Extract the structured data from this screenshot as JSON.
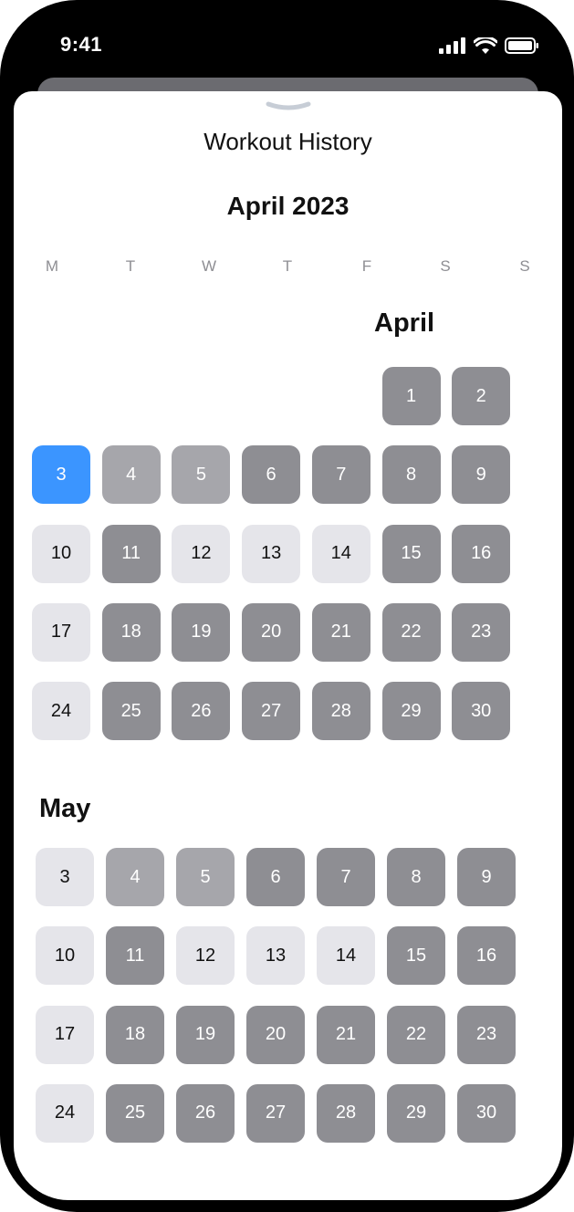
{
  "status": {
    "time": "9:41"
  },
  "sheet": {
    "title": "Workout History"
  },
  "header": {
    "month": "April 2023"
  },
  "weekdays": [
    "M",
    "T",
    "W",
    "T",
    "F",
    "S",
    "S"
  ],
  "colors": {
    "dark": "#8e8e93",
    "mid": "#a6a6ab",
    "light": "#e5e5ea",
    "selected": "#3b95ff"
  },
  "months": [
    {
      "label": "April",
      "rows": [
        [
          null,
          null,
          null,
          null,
          null,
          {
            "d": "1",
            "s": "dark"
          },
          {
            "d": "2",
            "s": "dark"
          }
        ],
        [
          {
            "d": "3",
            "s": "selected"
          },
          {
            "d": "4",
            "s": "mid"
          },
          {
            "d": "5",
            "s": "mid"
          },
          {
            "d": "6",
            "s": "dark"
          },
          {
            "d": "7",
            "s": "dark"
          },
          {
            "d": "8",
            "s": "dark"
          },
          {
            "d": "9",
            "s": "dark"
          }
        ],
        [
          {
            "d": "10",
            "s": "light"
          },
          {
            "d": "11",
            "s": "dark"
          },
          {
            "d": "12",
            "s": "light"
          },
          {
            "d": "13",
            "s": "light"
          },
          {
            "d": "14",
            "s": "light"
          },
          {
            "d": "15",
            "s": "dark"
          },
          {
            "d": "16",
            "s": "dark"
          }
        ],
        [
          {
            "d": "17",
            "s": "light"
          },
          {
            "d": "18",
            "s": "dark"
          },
          {
            "d": "19",
            "s": "dark"
          },
          {
            "d": "20",
            "s": "dark"
          },
          {
            "d": "21",
            "s": "dark"
          },
          {
            "d": "22",
            "s": "dark"
          },
          {
            "d": "23",
            "s": "dark"
          }
        ],
        [
          {
            "d": "24",
            "s": "light"
          },
          {
            "d": "25",
            "s": "dark"
          },
          {
            "d": "26",
            "s": "dark"
          },
          {
            "d": "27",
            "s": "dark"
          },
          {
            "d": "28",
            "s": "dark"
          },
          {
            "d": "29",
            "s": "dark"
          },
          {
            "d": "30",
            "s": "dark"
          }
        ]
      ]
    },
    {
      "label": "May",
      "rows": [
        [
          {
            "d": "3",
            "s": "light"
          },
          {
            "d": "4",
            "s": "mid"
          },
          {
            "d": "5",
            "s": "mid"
          },
          {
            "d": "6",
            "s": "dark"
          },
          {
            "d": "7",
            "s": "dark"
          },
          {
            "d": "8",
            "s": "dark"
          },
          {
            "d": "9",
            "s": "dark"
          }
        ],
        [
          {
            "d": "10",
            "s": "light"
          },
          {
            "d": "11",
            "s": "dark"
          },
          {
            "d": "12",
            "s": "light"
          },
          {
            "d": "13",
            "s": "light"
          },
          {
            "d": "14",
            "s": "light"
          },
          {
            "d": "15",
            "s": "dark"
          },
          {
            "d": "16",
            "s": "dark"
          }
        ],
        [
          {
            "d": "17",
            "s": "light"
          },
          {
            "d": "18",
            "s": "dark"
          },
          {
            "d": "19",
            "s": "dark"
          },
          {
            "d": "20",
            "s": "dark"
          },
          {
            "d": "21",
            "s": "dark"
          },
          {
            "d": "22",
            "s": "dark"
          },
          {
            "d": "23",
            "s": "dark"
          }
        ],
        [
          {
            "d": "24",
            "s": "light"
          },
          {
            "d": "25",
            "s": "dark"
          },
          {
            "d": "26",
            "s": "dark"
          },
          {
            "d": "27",
            "s": "dark"
          },
          {
            "d": "28",
            "s": "dark"
          },
          {
            "d": "29",
            "s": "dark"
          },
          {
            "d": "30",
            "s": "dark"
          }
        ]
      ]
    }
  ]
}
